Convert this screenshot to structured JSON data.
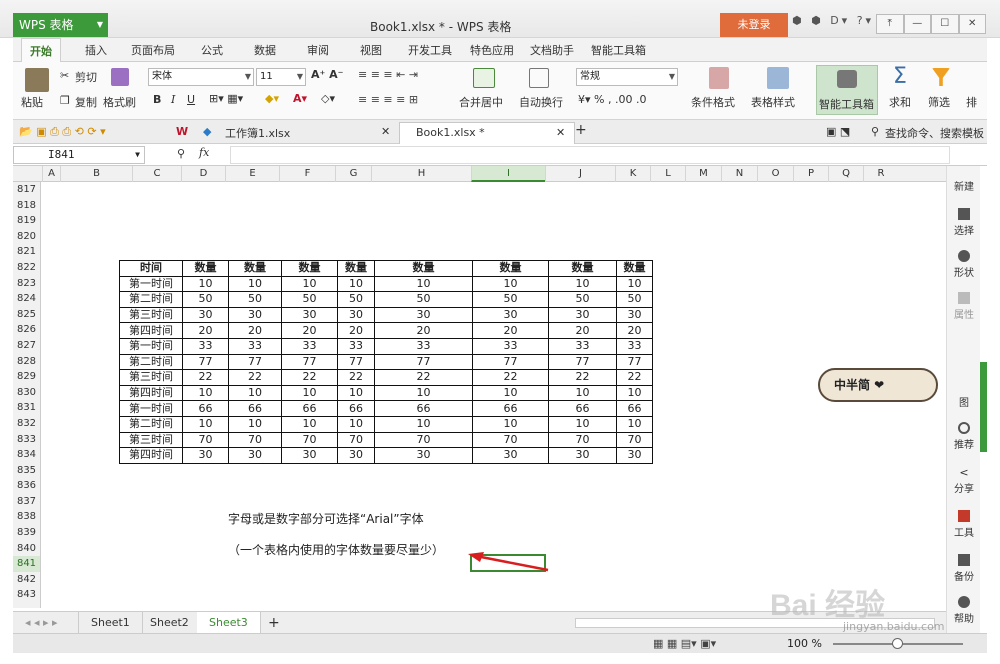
{
  "app": {
    "button": "WPS 表格",
    "title": "Book1.xlsx * - WPS 表格",
    "login": "未登录",
    "controls_text": "⬢ ⬢ D▾ ?▾",
    "window": [
      "⤒",
      "—",
      "☐",
      "✕"
    ]
  },
  "tabs": [
    "开始",
    "插入",
    "页面布局",
    "公式",
    "数据",
    "审阅",
    "视图",
    "开发工具",
    "特色应用",
    "文档助手",
    "智能工具箱"
  ],
  "ribbon": {
    "paste": "粘贴",
    "cut": "剪切",
    "copy": "复制",
    "format_painter": "格式刷",
    "font": "宋体",
    "size": "11",
    "bold": "B",
    "italic": "I",
    "underline": "U",
    "merge": "合并居中",
    "wrap": "自动换行",
    "numfmt": "常规",
    "cond_format": "条件格式",
    "table_style": "表格样式",
    "smart_tools": "智能工具箱",
    "sum": "求和",
    "filter": "筛选",
    "sort": "排"
  },
  "doctabs": {
    "tab1": "工作簿1.xlsx",
    "tab2": "Book1.xlsx *",
    "search": "查找命令、搜索模板"
  },
  "formula": {
    "cell": "I841",
    "fx": "fx"
  },
  "columns": [
    "A",
    "B",
    "C",
    "D",
    "E",
    "F",
    "G",
    "H",
    "I",
    "J",
    "K",
    "L",
    "M",
    "N",
    "O",
    "P",
    "Q",
    "R"
  ],
  "rows": [
    "817",
    "818",
    "819",
    "820",
    "821",
    "822",
    "823",
    "824",
    "825",
    "826",
    "827",
    "828",
    "829",
    "830",
    "831",
    "832",
    "833",
    "834",
    "835",
    "836",
    "837",
    "838",
    "839",
    "840",
    "841",
    "842",
    "843"
  ],
  "table": {
    "header": [
      "时间",
      "数量",
      "数量",
      "数量",
      "数量",
      "数量",
      "数量",
      "数量",
      "数量"
    ],
    "rows": [
      [
        "第一时间",
        "10",
        "10",
        "10",
        "10",
        "10",
        "10",
        "10",
        "10"
      ],
      [
        "第二时间",
        "50",
        "50",
        "50",
        "50",
        "50",
        "50",
        "50",
        "50"
      ],
      [
        "第三时间",
        "30",
        "30",
        "30",
        "30",
        "30",
        "30",
        "30",
        "30"
      ],
      [
        "第四时间",
        "20",
        "20",
        "20",
        "20",
        "20",
        "20",
        "20",
        "20"
      ],
      [
        "第一时间",
        "33",
        "33",
        "33",
        "33",
        "33",
        "33",
        "33",
        "33"
      ],
      [
        "第二时间",
        "77",
        "77",
        "77",
        "77",
        "77",
        "77",
        "77",
        "77"
      ],
      [
        "第三时间",
        "22",
        "22",
        "22",
        "22",
        "22",
        "22",
        "22",
        "22"
      ],
      [
        "第四时间",
        "10",
        "10",
        "10",
        "10",
        "10",
        "10",
        "10",
        "10"
      ],
      [
        "第一时间",
        "66",
        "66",
        "66",
        "66",
        "66",
        "66",
        "66",
        "66"
      ],
      [
        "第二时间",
        "10",
        "10",
        "10",
        "10",
        "10",
        "10",
        "10",
        "10"
      ],
      [
        "第三时间",
        "70",
        "70",
        "70",
        "70",
        "70",
        "70",
        "70",
        "70"
      ],
      [
        "第四时间",
        "30",
        "30",
        "30",
        "30",
        "30",
        "30",
        "30",
        "30"
      ]
    ]
  },
  "notes": [
    "字母或是数字部分可选择“Arial”字体",
    "（一个表格内使用的字体数量要尽量少）"
  ],
  "sidebar": [
    "新建",
    "选择",
    "形状",
    "属性",
    "",
    "图",
    "推荐",
    "分享",
    "工具",
    "备份",
    "帮助"
  ],
  "sheets": [
    "Sheet1",
    "Sheet2",
    "Sheet3",
    "+"
  ],
  "status": {
    "zoom": "100 %"
  },
  "sticker": "中半简 ❤",
  "watermark": {
    "text": "Bai 经验",
    "url": "jingyan.baidu.com"
  }
}
